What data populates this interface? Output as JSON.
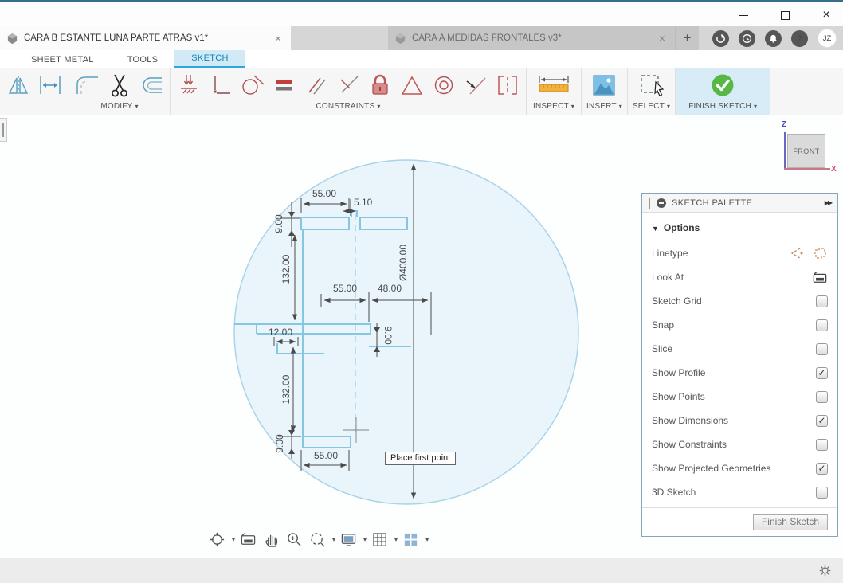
{
  "titlebar": {
    "close_glyph": "×"
  },
  "doc_tabs": {
    "active_label": "CARA B ESTANTE LUNA PARTE ATRAS v1*",
    "inactive_label": "CARA A MEDIDAS FRONTALES v3*",
    "close_glyph": "×",
    "new_tab_glyph": "+"
  },
  "account_initials": "JZ",
  "topbar_icon_names": [
    "extensions-icon",
    "job-status-icon",
    "notifications-icon",
    "help-icon",
    "avatar"
  ],
  "ribbon": {
    "tabs": [
      "SHEET METAL",
      "TOOLS",
      "SKETCH"
    ],
    "active_tab": "SKETCH",
    "caret": "▾",
    "groups": {
      "modify": "MODIFY",
      "constraints": "CONSTRAINTS",
      "inspect": "INSPECT",
      "insert": "INSERT",
      "select": "SELECT",
      "finish_sketch": "FINISH SKETCH"
    },
    "icon_names": [
      "mirror-icon",
      "sketch-dimension-icon",
      "fillet-icon",
      "trim-icon",
      "offset-icon",
      "coincident-icon",
      "horizontal-vertical-icon",
      "tangent-icon",
      "equal-icon",
      "parallel-icon",
      "perpendicular-icon",
      "fix-lock-icon",
      "triangle-constraint-icon",
      "concentric-icon",
      "midpoint-icon",
      "symmetry-icon",
      "measure-icon",
      "insert-image-icon",
      "select-icon",
      "finish-sketch-check-icon"
    ]
  },
  "viewcube": {
    "face": "FRONT",
    "z": "Z",
    "x": "X"
  },
  "canvas": {
    "tooltip": "Place first point",
    "dimensions": {
      "diameter": "Ø400.00",
      "top_width": "55.00",
      "top_notch": "5.10",
      "top_thickness": "9.00",
      "upper_height": "132.00",
      "mid_left_width": "55.00",
      "mid_right_width": "48.00",
      "mid_notch": "12.00",
      "mid_thickness": "9.00",
      "lower_height": "132.00",
      "bottom_thickness": "9.00",
      "bottom_width": "55.00"
    }
  },
  "navbar_icon_names": [
    "orbit-icon",
    "look-at-icon",
    "pan-icon",
    "zoom-icon",
    "zoom-window-icon",
    "display-settings-icon",
    "grid-settings-icon",
    "viewports-icon"
  ],
  "palette": {
    "title": "SKETCH PALETTE",
    "expand_glyph": "▶▶",
    "section": "Options",
    "section_tri": "▼",
    "check_glyph": "✓",
    "rows": [
      {
        "label": "Linetype",
        "control": "icons",
        "checked": null
      },
      {
        "label": "Look At",
        "control": "icon",
        "checked": null
      },
      {
        "label": "Sketch Grid",
        "checked": false
      },
      {
        "label": "Snap",
        "checked": false
      },
      {
        "label": "Slice",
        "checked": false
      },
      {
        "label": "Show Profile",
        "checked": true
      },
      {
        "label": "Show Points",
        "checked": false
      },
      {
        "label": "Show Dimensions",
        "checked": true
      },
      {
        "label": "Show Constraints",
        "checked": false
      },
      {
        "label": "Show Projected Geometries",
        "checked": true
      },
      {
        "label": "3D Sketch",
        "checked": false
      }
    ],
    "finish_button": "Finish Sketch"
  }
}
